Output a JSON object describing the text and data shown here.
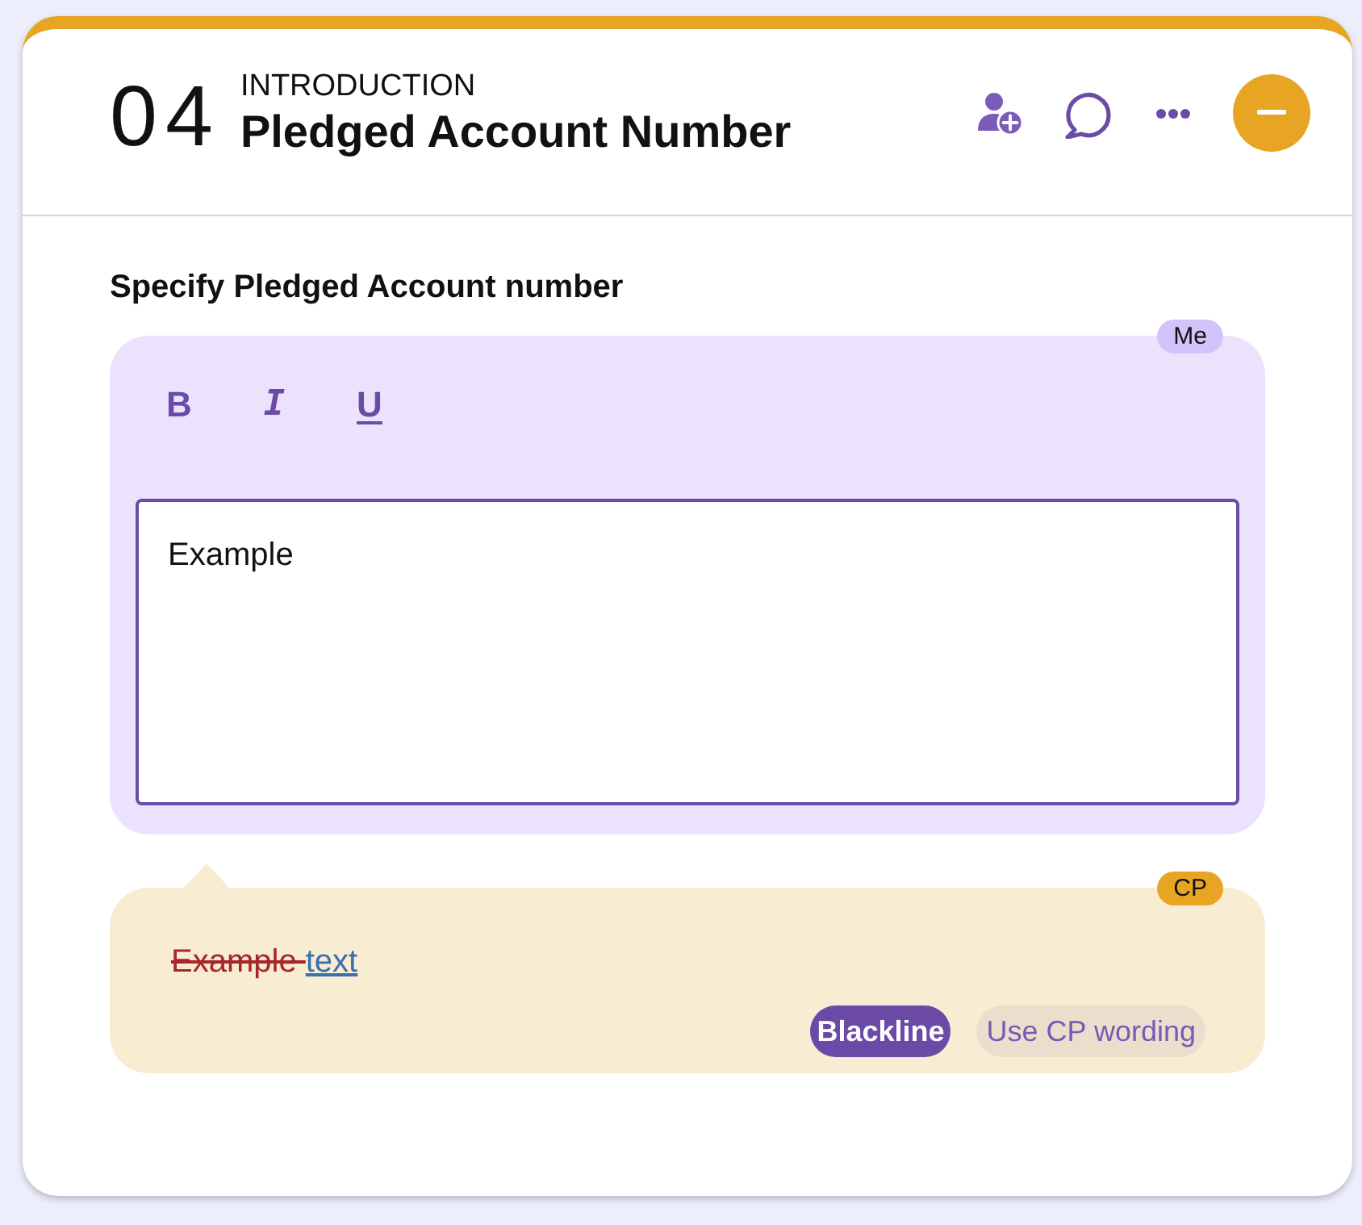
{
  "section": {
    "number": "04",
    "category": "INTRODUCTION",
    "title": "Pledged Account Number",
    "expanded": true
  },
  "question": {
    "label": "Specify Pledged Account number"
  },
  "editor": {
    "author_badge": "Me",
    "toolbar": [
      {
        "label": "B",
        "kind": "bold"
      },
      {
        "label": "I",
        "kind": "italic"
      },
      {
        "label": "U",
        "kind": "underline"
      }
    ],
    "value": "Example"
  },
  "counterparty": {
    "author_badge": "CP",
    "diff": [
      {
        "kind": "deleted",
        "text": "Example "
      },
      {
        "kind": "inserted",
        "text": "text"
      }
    ],
    "buttons": [
      {
        "label": "Blackline",
        "selected": true
      },
      {
        "label": "Use CP wording",
        "selected": false
      }
    ]
  }
}
